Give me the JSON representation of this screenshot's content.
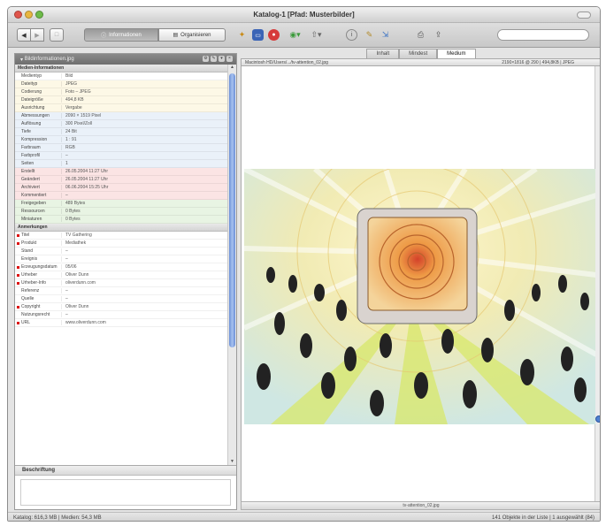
{
  "window": {
    "title": "Katalog-1 [Pfad: Musterbilder]"
  },
  "toolbar": {
    "back": "◀",
    "forward": "▶",
    "mode": "□",
    "seg_left": "Informationen",
    "seg_right": "Organisieren",
    "search_placeholder": ""
  },
  "left_panel": {
    "header": "Bildinformationen.jpg",
    "sections": [
      {
        "title": "Medien-Informationen",
        "rows": [
          {
            "key": "Medientyp",
            "value": "Bild",
            "color": "#ffffff",
            "mark": false
          },
          {
            "key": "Dateityp",
            "value": "JPEG",
            "color": "#fdf8e6",
            "mark": false
          },
          {
            "key": "Codierung",
            "value": "Foto – JPEG",
            "color": "#fdf8e6",
            "mark": false
          },
          {
            "key": "Dateigröße",
            "value": "494,8 KB",
            "color": "#fdf8e6",
            "mark": false
          },
          {
            "key": "Ausrichtung",
            "value": "Vergabe",
            "color": "#fdf8e6",
            "mark": false
          },
          {
            "key": "Abmessungen",
            "value": "2090 × 1519 Pixel",
            "color": "#eaf1f9",
            "mark": false
          },
          {
            "key": "Auflösung",
            "value": "300 Pixel/Zoll",
            "color": "#eaf1f9",
            "mark": false
          },
          {
            "key": "Tiefe",
            "value": "24 Bit",
            "color": "#eaf1f9",
            "mark": false
          },
          {
            "key": "Kompression",
            "value": "1 : 91",
            "color": "#eaf1f9",
            "mark": false
          },
          {
            "key": "Farbraum",
            "value": "RGB",
            "color": "#eaf1f9",
            "mark": false
          },
          {
            "key": "Farbprofil",
            "value": "–",
            "color": "#eaf1f9",
            "mark": false
          },
          {
            "key": "Seiten",
            "value": "1",
            "color": "#eaf1f9",
            "mark": false
          },
          {
            "key": "Erstellt",
            "value": "26.05.2004 11:27 Uhr",
            "color": "#fbe4e4",
            "mark": false
          },
          {
            "key": "Geändert",
            "value": "26.05.2004 11:27 Uhr",
            "color": "#fbe4e4",
            "mark": false
          },
          {
            "key": "Archiviert",
            "value": "06.06.2004 15:25 Uhr",
            "color": "#fbe4e4",
            "mark": false
          },
          {
            "key": "Kommentiert",
            "value": "–",
            "color": "#fbe4e4",
            "mark": false
          },
          {
            "key": "Freigegeben",
            "value": "489 Bytes",
            "color": "#e8f4e3",
            "mark": false
          },
          {
            "key": "Ressourcen",
            "value": "0 Bytes",
            "color": "#e8f4e3",
            "mark": false
          },
          {
            "key": "Miniaturen",
            "value": "0 Bytes",
            "color": "#e8f4e3",
            "mark": false
          }
        ]
      },
      {
        "title": "Anmerkungen",
        "rows": [
          {
            "key": "Titel",
            "value": "TV Gathering",
            "color": "#ffffff",
            "mark": true
          },
          {
            "key": "Produkt",
            "value": "Mediathek",
            "color": "#ffffff",
            "mark": true
          },
          {
            "key": "Stand",
            "value": "–",
            "color": "#ffffff",
            "mark": false
          },
          {
            "key": "Ereignis",
            "value": "–",
            "color": "#ffffff",
            "mark": false
          },
          {
            "key": "Erzeugungsdatum",
            "value": "05/06",
            "color": "#ffffff",
            "mark": true
          },
          {
            "key": "Urheber",
            "value": "Oliver Dunn",
            "color": "#ffffff",
            "mark": true
          },
          {
            "key": "Urheber-Info",
            "value": "oliverdunn.com",
            "color": "#ffffff",
            "mark": true
          },
          {
            "key": "Referenz",
            "value": "–",
            "color": "#ffffff",
            "mark": false
          },
          {
            "key": "Quelle",
            "value": "–",
            "color": "#ffffff",
            "mark": false
          },
          {
            "key": "Copyright",
            "value": "Oliver Dunn",
            "color": "#ffffff",
            "mark": true
          },
          {
            "key": "Nutzungsrecht",
            "value": "–",
            "color": "#ffffff",
            "mark": false
          },
          {
            "key": "URL",
            "value": "www.oliverdunn.com",
            "color": "#ffffff",
            "mark": true
          }
        ]
      }
    ],
    "caption_title": "Beschriftung"
  },
  "right_panel": {
    "tabs": [
      "Inhalt",
      "Mindest",
      "Medium"
    ],
    "active_tab": 2,
    "path_left": "Macintosh HD/Users/.../tv-attention_02.jpg",
    "path_right": "2190×1816 @ 290  |  494,8KB  |  JPEG",
    "filename": "tv-attention_02.jpg"
  },
  "status": {
    "left": "Katalog: 616,3 MB  |  Medien: 54,3 MB",
    "right": "141 Objekte in der Liste  |  1 ausgewählt (84)"
  },
  "colors": {
    "selection_blue": "#4e7fd0",
    "mark_red": "#d11111"
  }
}
